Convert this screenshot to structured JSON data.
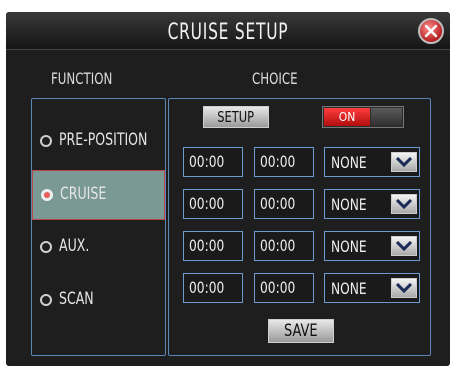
{
  "dialog": {
    "title": "CRUISE  SETUP",
    "close_icon": "close-icon"
  },
  "headers": {
    "function": "FUNCTION",
    "choice": "CHOICE"
  },
  "functions": [
    {
      "label": "PRE-POSITION",
      "selected": false
    },
    {
      "label": "CRUISE",
      "selected": true
    },
    {
      "label": "AUX.",
      "selected": false
    },
    {
      "label": "SCAN",
      "selected": false
    }
  ],
  "choice": {
    "setup_label": "SETUP",
    "toggle_label": "ON",
    "toggle_state": true,
    "rows": [
      {
        "start": "00:00",
        "end": "00:00",
        "option": "NONE"
      },
      {
        "start": "00:00",
        "end": "00:00",
        "option": "NONE"
      },
      {
        "start": "00:00",
        "end": "00:00",
        "option": "NONE"
      },
      {
        "start": "00:00",
        "end": "00:00",
        "option": "NONE"
      }
    ],
    "save_label": "SAVE"
  },
  "colors": {
    "accent_border": "#6e9bd0",
    "selected_bg": "#7a9994",
    "toggle_on": "#e01a1a"
  }
}
